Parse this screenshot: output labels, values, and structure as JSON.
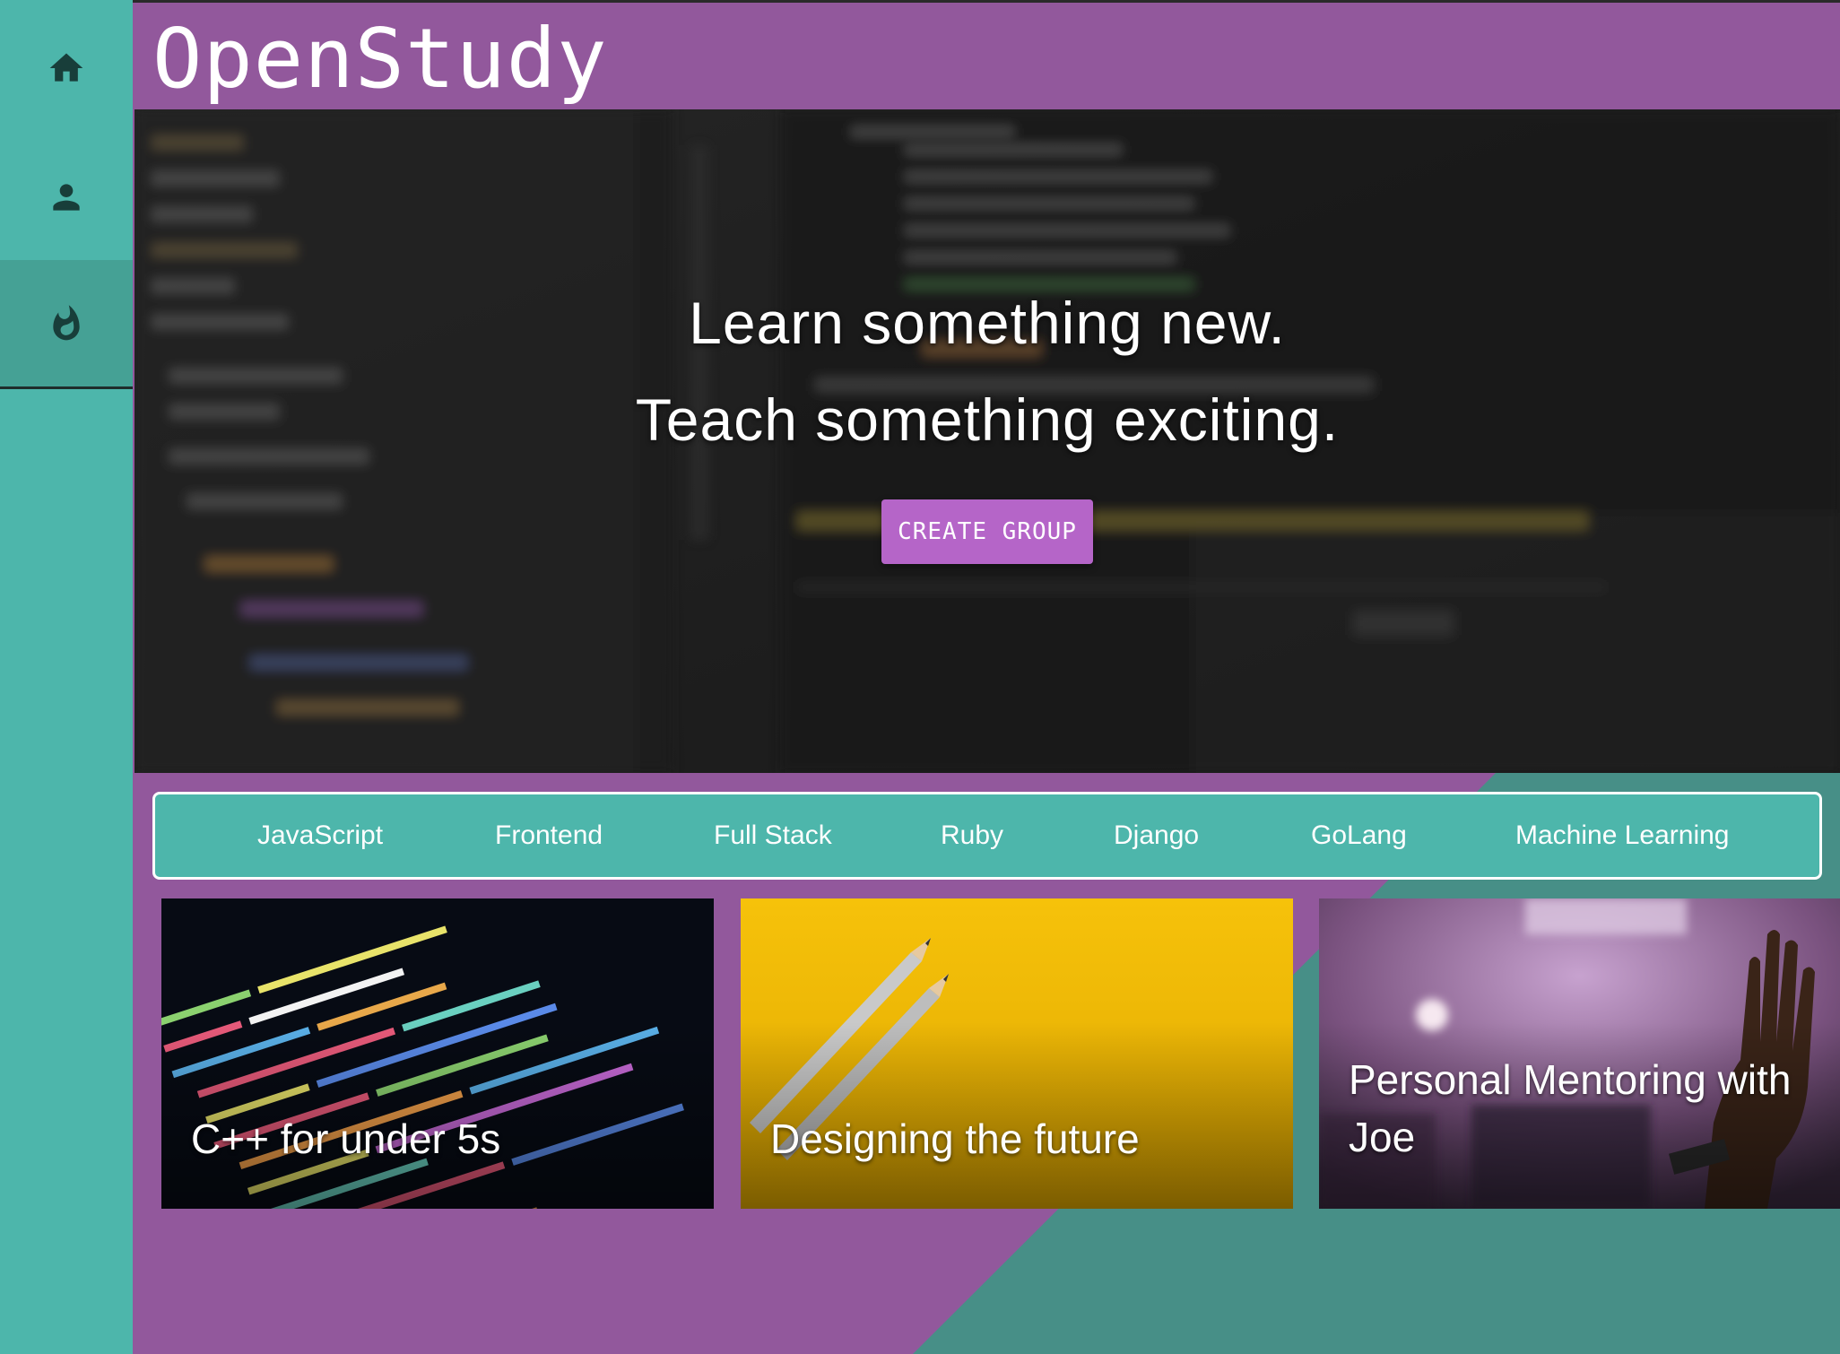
{
  "app": {
    "title": "OpenStudy"
  },
  "sidebar": {
    "items": [
      {
        "icon": "home-icon"
      },
      {
        "icon": "person-icon"
      },
      {
        "icon": "fire-icon",
        "active": true
      }
    ]
  },
  "hero": {
    "line1": "Learn something new.",
    "line2": "Teach something exciting.",
    "cta_label": "CREATE GROUP"
  },
  "tags": [
    "JavaScript",
    "Frontend",
    "Full Stack",
    "Ruby",
    "Django",
    "GoLang",
    "Machine Learning"
  ],
  "cards": [
    {
      "title": "C++ for under 5s"
    },
    {
      "title": "Designing the future"
    },
    {
      "title": "Personal Mentoring with Joe"
    }
  ],
  "colors": {
    "purple": "#92589c",
    "teal": "#4db6ab",
    "dark_teal": "#478f87",
    "button": "#b565c8"
  }
}
